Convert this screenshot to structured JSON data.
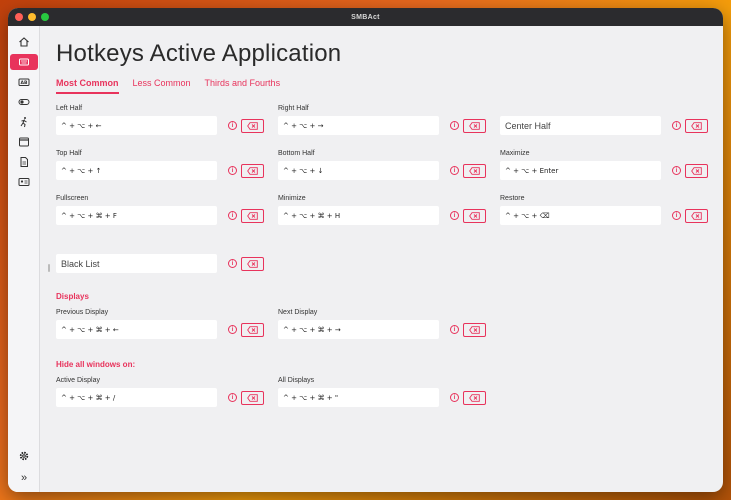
{
  "app": {
    "title": "SMBAct"
  },
  "page": {
    "title": "Hotkeys Active Application"
  },
  "tabs": [
    {
      "label": "Most Common",
      "active": true
    },
    {
      "label": "Less Common",
      "active": false
    },
    {
      "label": "Thirds and Fourths",
      "active": false
    }
  ],
  "sidebar": {
    "items": [
      {
        "icon": "home-icon",
        "active": false
      },
      {
        "icon": "keyboard-icon",
        "active": true
      },
      {
        "icon": "ab-icon",
        "active": false
      },
      {
        "icon": "toggle-icon",
        "active": false
      },
      {
        "icon": "running-icon",
        "active": false
      },
      {
        "icon": "window-icon",
        "active": false
      },
      {
        "icon": "document-icon",
        "active": false
      },
      {
        "icon": "id-card-icon",
        "active": false
      }
    ],
    "settings_icon": "gear-icon",
    "collapse_label": "»"
  },
  "fields": {
    "left_half": {
      "label": "Left Half",
      "value": "^ + ⌥ + ←"
    },
    "right_half": {
      "label": "Right Half",
      "value": "^ + ⌥ + →"
    },
    "center_half": {
      "label": "",
      "value": "Center Half"
    },
    "top_half": {
      "label": "Top Half",
      "value": "^ + ⌥ + ↑"
    },
    "bottom_half": {
      "label": "Bottom Half",
      "value": "^ + ⌥ + ↓"
    },
    "maximize": {
      "label": "Maximize",
      "value": "^ + ⌥ + Enter"
    },
    "fullscreen": {
      "label": "Fullscreen",
      "value": "^ + ⌥ + ⌘ + F"
    },
    "minimize": {
      "label": "Minimize",
      "value": "^ + ⌥ + ⌘ + H"
    },
    "restore": {
      "label": "Restore",
      "value": "^ + ⌥ + ⌫"
    },
    "black_list": {
      "label": "",
      "value": "Black List"
    },
    "previous_display": {
      "label": "Previous Display",
      "value": "^ + ⌥ + ⌘ + ←"
    },
    "next_display": {
      "label": "Next Display",
      "value": "^ + ⌥ + ⌘ + →"
    },
    "active_display": {
      "label": "Active Display",
      "value": "^ + ⌥ + ⌘ + /"
    },
    "all_displays": {
      "label": "All Displays",
      "value": "^ + ⌥ + ⌘ + \""
    }
  },
  "sections": {
    "displays": "Displays",
    "hide_all": "Hide all windows on:"
  },
  "colors": {
    "accent": "#e8335c",
    "background": "#f0f0f2",
    "titlebar": "#2b2b2e"
  }
}
